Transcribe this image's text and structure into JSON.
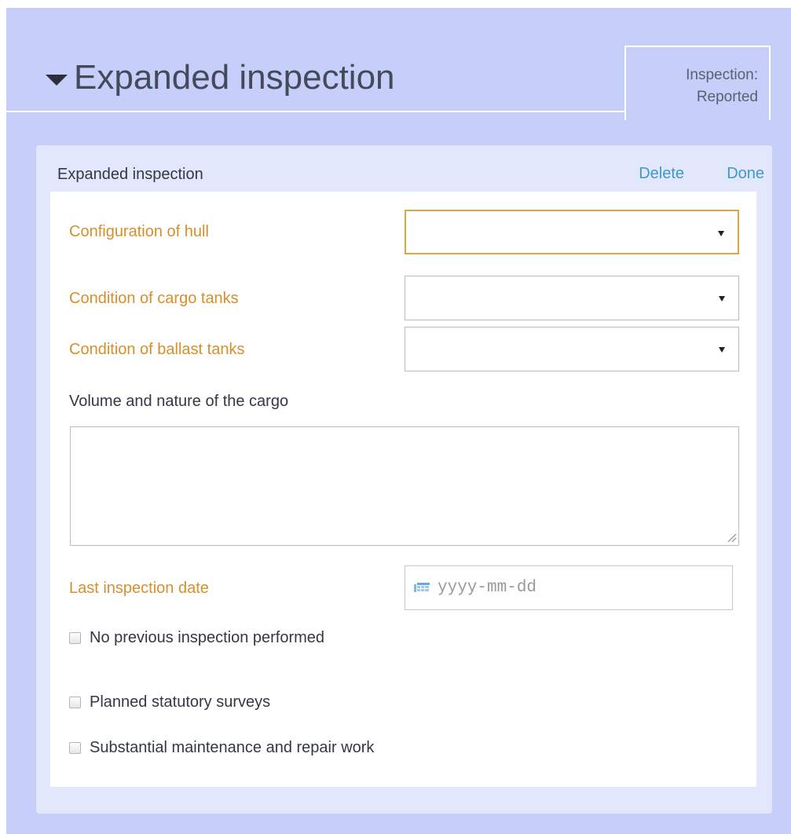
{
  "section": {
    "title": "Expanded inspection",
    "caret_icon": "caret-down-icon"
  },
  "status_tab": {
    "line1": "Inspection:",
    "line2": "Reported"
  },
  "panel": {
    "title": "Expanded inspection",
    "delete_label": "Delete",
    "done_label": "Done"
  },
  "form": {
    "hull_config": {
      "label": "Configuration of hull",
      "value": ""
    },
    "cargo_tanks": {
      "label": "Condition of cargo tanks",
      "value": ""
    },
    "ballast_tanks": {
      "label": "Condition of ballast tanks",
      "value": ""
    },
    "cargo_volume": {
      "label": "Volume and nature of the cargo",
      "value": ""
    },
    "last_inspection": {
      "label": "Last inspection date",
      "placeholder": "yyyy-mm-dd",
      "icon": "calendar-icon"
    },
    "checkboxes": {
      "no_previous": "No previous inspection performed",
      "planned_surveys": "Planned statutory surveys",
      "maintenance": "Substantial maintenance and repair work"
    }
  },
  "colors": {
    "outer_background": "#c6cff9",
    "panel_background": "#e3e7fb",
    "required_label": "#d68f2c",
    "link": "#3d9ac8",
    "focus_border": "#e4a53f"
  }
}
